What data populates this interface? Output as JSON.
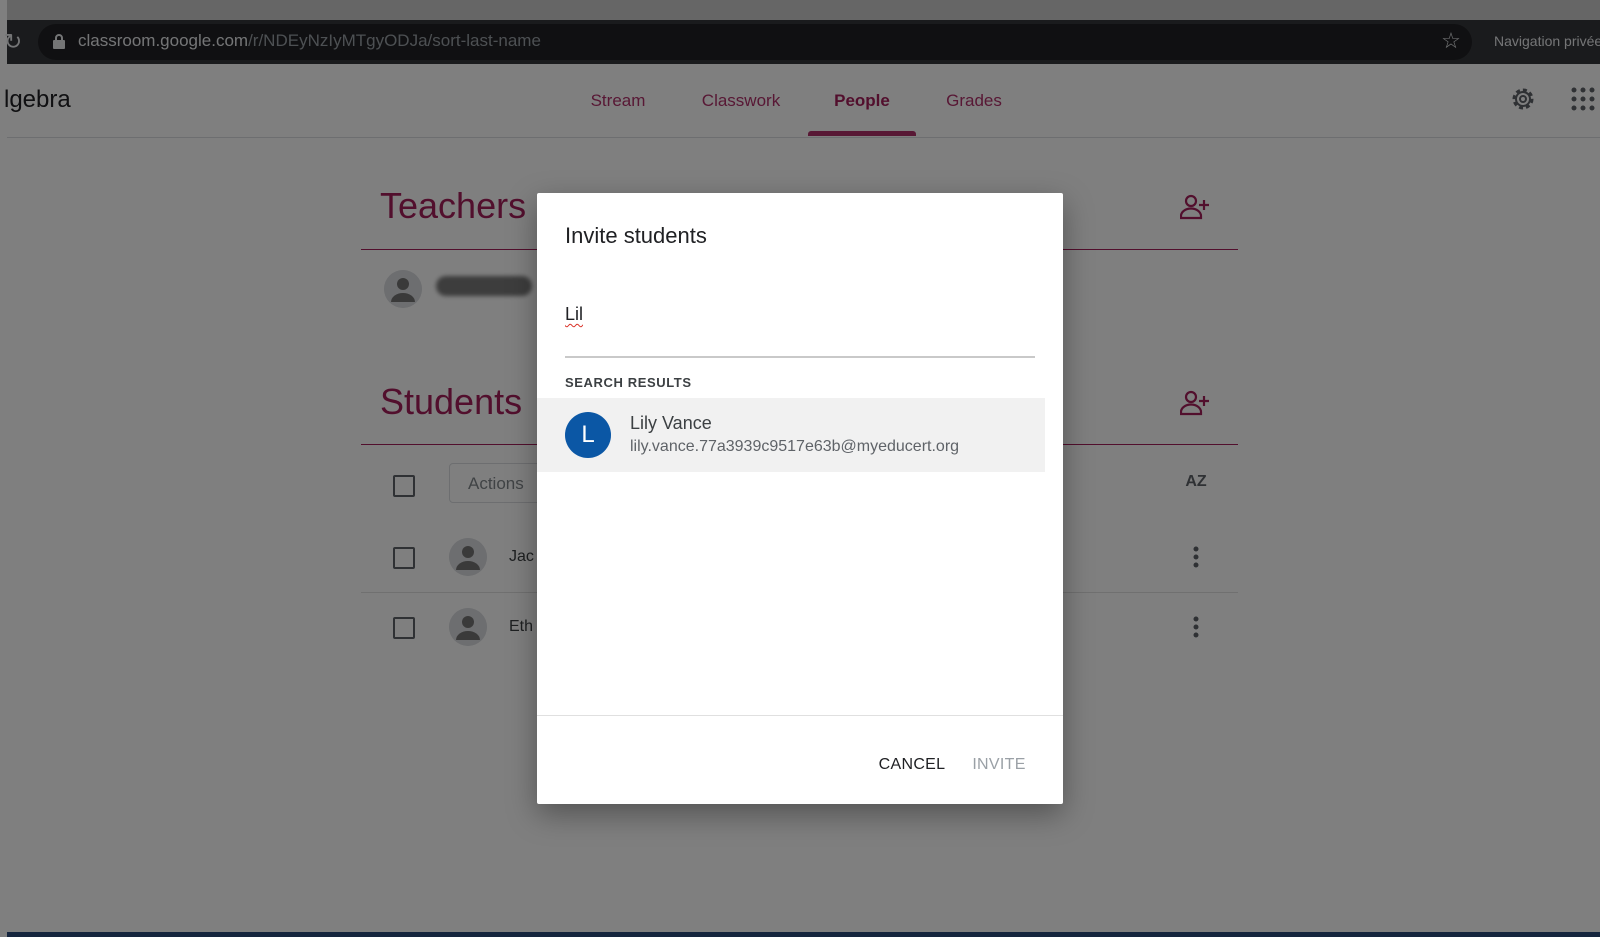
{
  "browser": {
    "url_domain": "classroom.google.com",
    "url_path": "/r/NDEyNzIyMTgyODJa/sort-last-name",
    "private_label": "Navigation privée"
  },
  "app": {
    "class_title": "lgebra",
    "tabs": [
      {
        "label": "Stream"
      },
      {
        "label": "Classwork"
      },
      {
        "label": "People",
        "active": true
      },
      {
        "label": "Grades"
      }
    ]
  },
  "people": {
    "teachers_title": "Teachers",
    "students_title": "Students",
    "actions_label": "Actions",
    "sort_label": "AZ",
    "students": [
      {
        "name": "Jac"
      },
      {
        "name": "Eth"
      }
    ]
  },
  "dialog": {
    "title": "Invite students",
    "search_value": "Lil",
    "results_heading": "SEARCH RESULTS",
    "result": {
      "initial": "L",
      "name": "Lily Vance",
      "email": "lily.vance.77a3939c9517e63b@myeducert.org"
    },
    "cancel_label": "CANCEL",
    "invite_label": "INVITE"
  },
  "colors": {
    "accent": "#b0306a",
    "result_avatar": "#0b57a5",
    "toolbar": "#35363a"
  },
  "icons": [
    "reload-icon",
    "lock-icon",
    "star-icon",
    "gear-icon",
    "apps-icon",
    "add-person-icon",
    "sort-icon",
    "more-vert-icon",
    "person-avatar-icon"
  ]
}
